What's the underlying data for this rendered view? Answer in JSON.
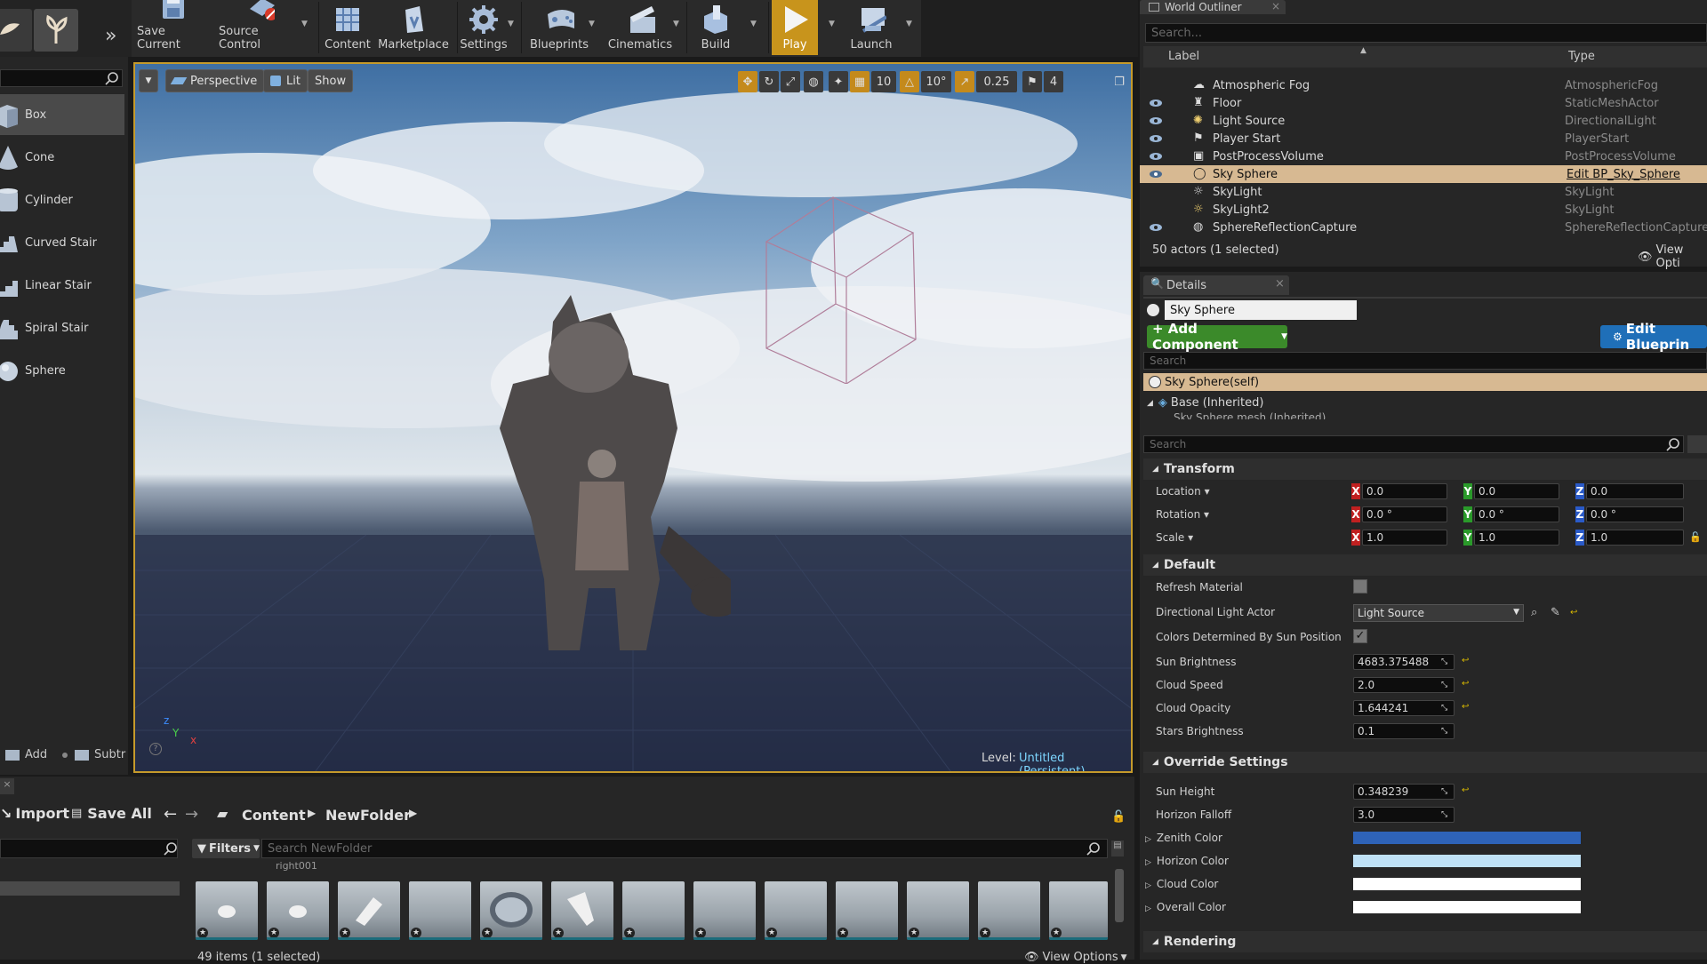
{
  "toolbar": {
    "buttons": [
      {
        "label": "Save Current"
      },
      {
        "label": "Source Control"
      },
      {
        "label": "Content"
      },
      {
        "label": "Marketplace"
      },
      {
        "label": "Settings"
      },
      {
        "label": "Blueprints"
      },
      {
        "label": "Cinematics"
      },
      {
        "label": "Build"
      },
      {
        "label": "Play"
      },
      {
        "label": "Launch"
      }
    ],
    "overflow": "»"
  },
  "place_panel": {
    "items": [
      "Box",
      "Cone",
      "Cylinder",
      "Curved Stair",
      "Linear Stair",
      "Spiral Stair",
      "Sphere"
    ],
    "add_label": "Add",
    "subtract_label": "Subtr"
  },
  "viewport": {
    "perspective": "Perspective",
    "lit": "Lit",
    "show": "Show",
    "grid_snap": "10",
    "rot_snap": "10°",
    "scale_snap": "0.25",
    "cam_speed": "4",
    "level_label": "Level:",
    "level_name": "Untitled (Persistent)",
    "axis_z": "z",
    "axis_y": "Y",
    "axis_x": "x"
  },
  "outliner": {
    "tab": "World Outliner",
    "search_placeholder": "Search...",
    "col_label": "Label",
    "col_type": "Type",
    "rows": [
      {
        "label": "Atmospheric Fog",
        "type": "AtmosphericFog"
      },
      {
        "label": "Floor",
        "type": "StaticMeshActor"
      },
      {
        "label": "Light Source",
        "type": "DirectionalLight"
      },
      {
        "label": "Player Start",
        "type": "PlayerStart"
      },
      {
        "label": "PostProcessVolume",
        "type": "PostProcessVolume"
      },
      {
        "label": "Sky Sphere",
        "type": "Edit BP_Sky_Sphere"
      },
      {
        "label": "SkyLight",
        "type": "SkyLight"
      },
      {
        "label": "SkyLight2",
        "type": "SkyLight"
      },
      {
        "label": "SphereReflectionCapture",
        "type": "SphereReflectionCapture"
      }
    ],
    "count": "50 actors (1 selected)",
    "view_options": "View Opti"
  },
  "details": {
    "tab": "Details",
    "actor_name": "Sky Sphere",
    "add_component": "+ Add Component",
    "edit_blueprint": "Edit Blueprin",
    "search_placeholder": "Search",
    "self_label": "Sky Sphere(self)",
    "base_inherited": "Base (Inherited)",
    "inherited_child": "Sky Sphere mesh (Inherited)",
    "search2_placeholder": "Search",
    "transform": "Transform",
    "location": {
      "label": "Location",
      "x": "0.0",
      "y": "0.0",
      "z": "0.0"
    },
    "rotation": {
      "label": "Rotation",
      "x": "0.0 °",
      "y": "0.0 °",
      "z": "0.0 °"
    },
    "scale": {
      "label": "Scale",
      "x": "1.0",
      "y": "1.0",
      "z": "1.0"
    },
    "default": "Default",
    "refresh_material": "Refresh Material",
    "directional_light_actor": "Directional Light Actor",
    "directional_light_value": "Light Source",
    "colors_by_sun": "Colors Determined By Sun Position",
    "sun_brightness": {
      "label": "Sun Brightness",
      "value": "4683.375488"
    },
    "cloud_speed": {
      "label": "Cloud Speed",
      "value": "2.0"
    },
    "cloud_opacity": {
      "label": "Cloud Opacity",
      "value": "1.644241"
    },
    "stars_brightness": {
      "label": "Stars Brightness",
      "value": "0.1"
    },
    "override": "Override Settings",
    "sun_height": {
      "label": "Sun Height",
      "value": "0.348239"
    },
    "horizon_falloff": {
      "label": "Horizon Falloff",
      "value": "3.0"
    },
    "zenith_color": {
      "label": "Zenith Color",
      "color": "#2e63b8"
    },
    "horizon_color": {
      "label": "Horizon Color",
      "color": "#bfe1f6"
    },
    "cloud_color": {
      "label": "Cloud Color",
      "color": "#ffffff"
    },
    "overall_color": {
      "label": "Overall Color",
      "color": "#ffffff"
    },
    "rendering": "Rendering"
  },
  "content_browser": {
    "import": "Import",
    "save_all": "Save All",
    "path_root": "Content",
    "path_folder": "NewFolder",
    "filters": "Filters",
    "search_placeholder": "Search NewFolder",
    "asset_partial": "right001",
    "count": "49 items (1 selected)",
    "view_options": "View Options"
  }
}
